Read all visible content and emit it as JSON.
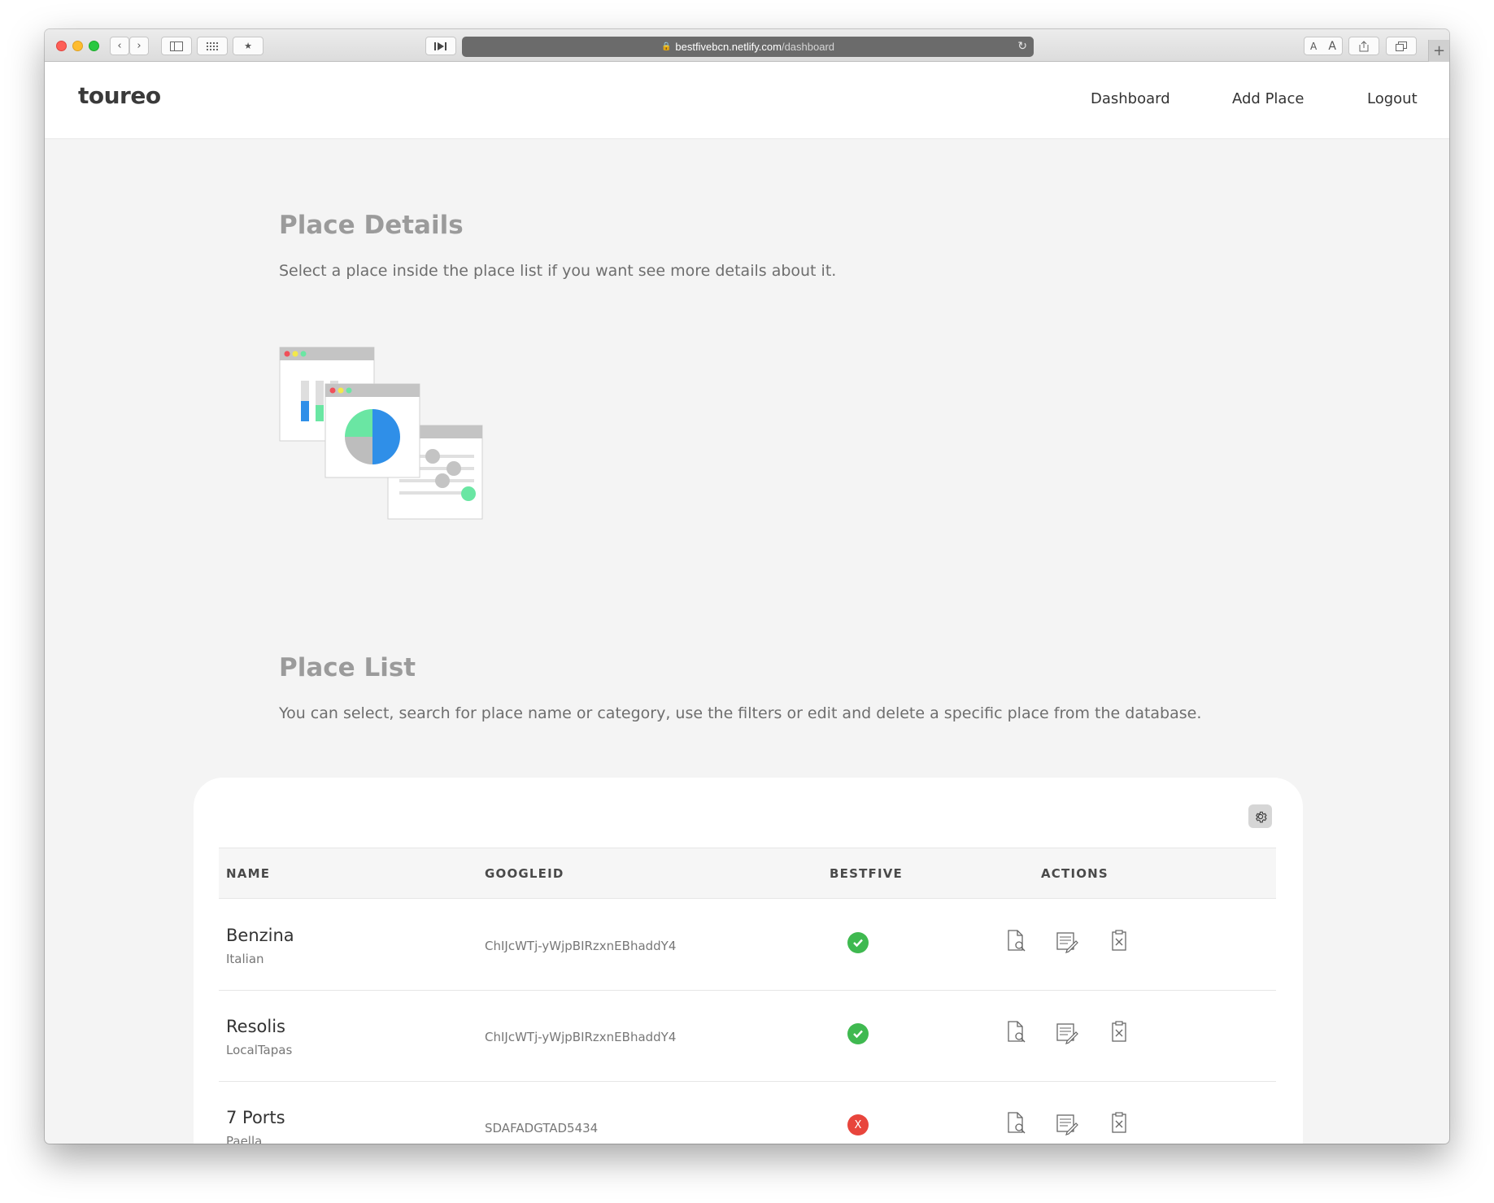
{
  "browser": {
    "url_host": "bestfivebcn.netlify.com",
    "url_path": "/dashboard"
  },
  "nav": {
    "brand": "toureo",
    "links": [
      "Dashboard",
      "Add Place",
      "Logout"
    ]
  },
  "details": {
    "title": "Place Details",
    "description": "Select a place inside the place list if you want see more details about it."
  },
  "list": {
    "title": "Place List",
    "description": "You can select, search for place name or category, use the filters or edit and delete a specific place from the database."
  },
  "table": {
    "columns": [
      "NAME",
      "GOOGLEID",
      "BESTFIVE",
      "ACTIONS"
    ],
    "rows": [
      {
        "name": "Benzina",
        "category": "Italian",
        "googleid": "ChIJcWTj-yWjpBIRzxnEBhaddY4",
        "bestfive": true
      },
      {
        "name": "Resolis",
        "category": "LocalTapas",
        "googleid": "ChIJcWTj-yWjpBIRzxnEBhaddY4",
        "bestfive": true
      },
      {
        "name": "7 Ports",
        "category": "Paella",
        "googleid": "SDAFADGTAD5434",
        "bestfive": false
      }
    ],
    "status_no_symbol": "X"
  },
  "icons": {
    "settings": "gear-icon",
    "view": "document-search-icon",
    "edit": "document-edit-icon",
    "delete": "clipboard-delete-icon",
    "bestfive_yes": "check-circle-icon",
    "bestfive_no": "x-circle-icon"
  },
  "colors": {
    "ok": "#3fb950",
    "no": "#e8453c",
    "accent_blue": "#2f8fe8",
    "accent_mint": "#5ee3a1"
  }
}
